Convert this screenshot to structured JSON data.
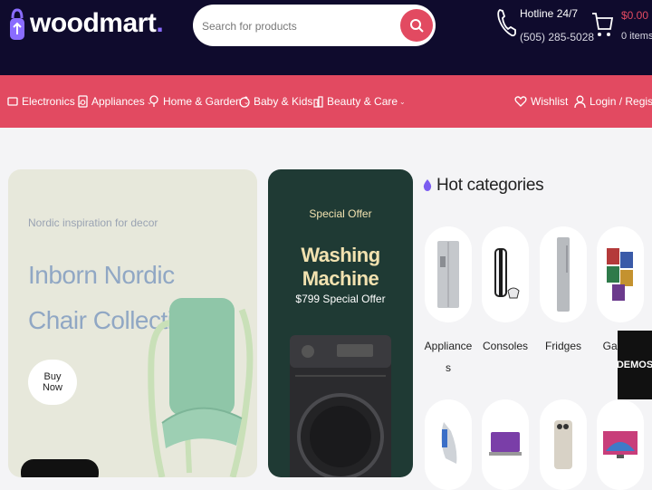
{
  "header": {
    "logo_text": "woodmart",
    "logo_dot": ".",
    "search": {
      "placeholder": "Search for products"
    },
    "hotline": {
      "title": "Hotline 24/7",
      "phone": "(505) 285-5028"
    },
    "cart": {
      "total": "$0.00",
      "items": "0 items"
    }
  },
  "nav": {
    "items": [
      {
        "label": "Electronics",
        "icon": "electronics-icon"
      },
      {
        "label": "Appliances",
        "icon": "appliances-icon"
      },
      {
        "label": "Home & Garden",
        "icon": "home-garden-icon"
      },
      {
        "label": "Baby & Kids",
        "icon": "baby-kids-icon"
      },
      {
        "label": "Beauty & Care",
        "icon": "beauty-care-icon"
      }
    ],
    "wishlist": "Wishlist",
    "login": "Login / Register"
  },
  "hero_left": {
    "subtitle": "Nordic inspiration for decor",
    "title_line1": "Inborn Nordic",
    "title_line2": "Chair Collection",
    "button": "Buy Now"
  },
  "hero_middle": {
    "subtitle": "Special Offer",
    "title": "Washing Machine",
    "price": "$799 Special Offer"
  },
  "hot_categories": {
    "title": "Hot categories",
    "items": [
      {
        "label_line1": "Appliance",
        "label_line2": "s"
      },
      {
        "label_line1": "Consoles",
        "label_line2": ""
      },
      {
        "label_line1": "Fridges",
        "label_line2": ""
      },
      {
        "label_line1": "Games",
        "label_line2": ""
      }
    ]
  },
  "demos_label": "DEMOS",
  "colors": {
    "header_bg": "#0f0b2d",
    "accent": "#e24a61",
    "page_bg": "#f4f4f6"
  }
}
